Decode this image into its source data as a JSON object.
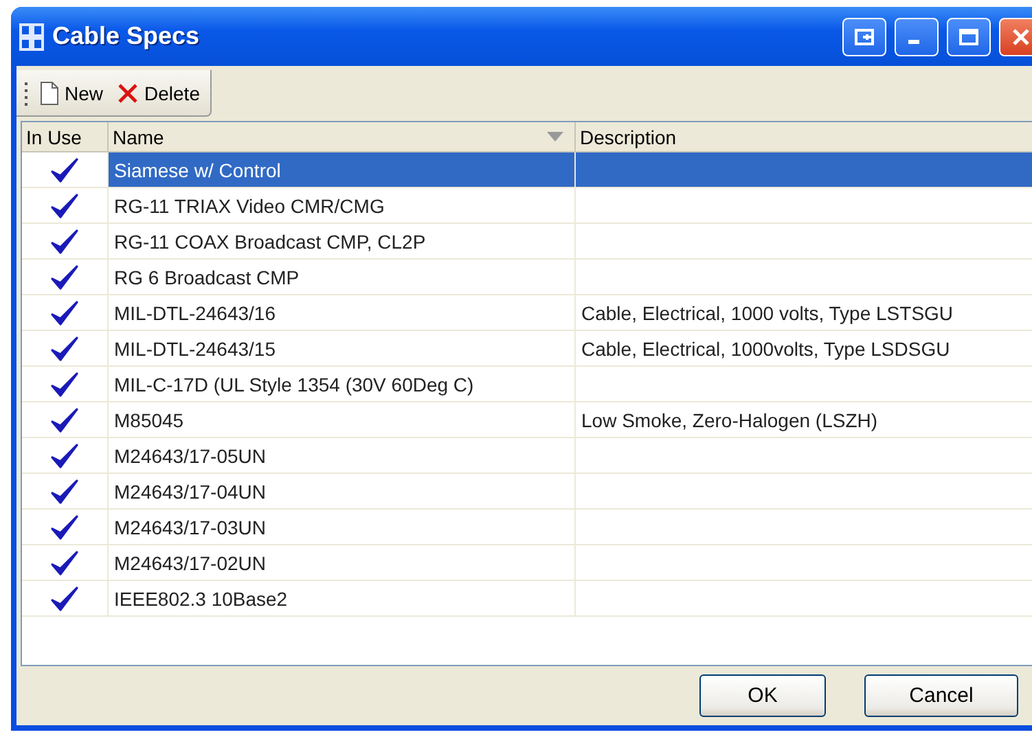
{
  "window": {
    "title": "Cable Specs"
  },
  "toolbar": [
    {
      "kind": "new",
      "label": "New"
    },
    {
      "kind": "delete",
      "label": "Delete"
    }
  ],
  "table": {
    "columns": [
      {
        "label": "In Use",
        "sort": false
      },
      {
        "label": "Name",
        "sort": true
      },
      {
        "label": "Description",
        "sort": false
      }
    ],
    "rows": [
      {
        "in_use": true,
        "name": "Siamese w/ Control",
        "description": "",
        "selected": true
      },
      {
        "in_use": true,
        "name": "RG-11 TRIAX Video CMR/CMG",
        "description": "",
        "selected": false
      },
      {
        "in_use": true,
        "name": "RG-11 COAX Broadcast CMP, CL2P",
        "description": "",
        "selected": false
      },
      {
        "in_use": true,
        "name": "RG 6 Broadcast CMP",
        "description": "",
        "selected": false
      },
      {
        "in_use": true,
        "name": "MIL-DTL-24643/16",
        "description": "Cable, Electrical, 1000 volts, Type LSTSGU",
        "selected": false
      },
      {
        "in_use": true,
        "name": "MIL-DTL-24643/15",
        "description": "Cable, Electrical, 1000volts, Type LSDSGU",
        "selected": false
      },
      {
        "in_use": true,
        "name": "MIL-C-17D (UL Style 1354 (30V 60Deg C)",
        "description": "",
        "selected": false
      },
      {
        "in_use": true,
        "name": "M85045",
        "description": "Low Smoke, Zero-Halogen (LSZH)",
        "selected": false
      },
      {
        "in_use": true,
        "name": "M24643/17-05UN",
        "description": "",
        "selected": false
      },
      {
        "in_use": true,
        "name": "M24643/17-04UN",
        "description": "",
        "selected": false
      },
      {
        "in_use": true,
        "name": "M24643/17-03UN",
        "description": "",
        "selected": false
      },
      {
        "in_use": true,
        "name": "M24643/17-02UN",
        "description": "",
        "selected": false
      },
      {
        "in_use": true,
        "name": "IEEE802.3 10Base2",
        "description": "",
        "selected": false
      }
    ]
  },
  "buttons": [
    "OK",
    "Cancel"
  ]
}
